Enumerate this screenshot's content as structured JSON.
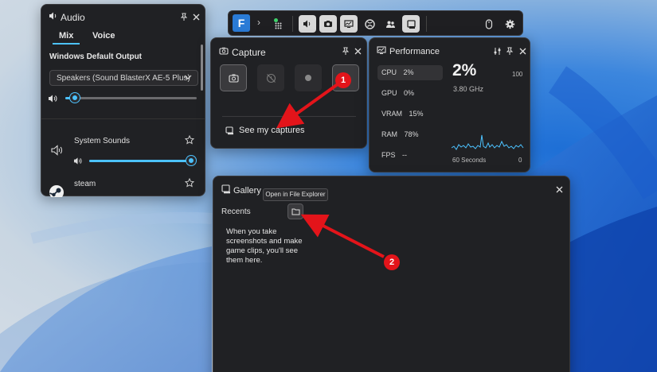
{
  "top_bar": {
    "buttons": [
      {
        "icon": "volume-icon",
        "active": true
      },
      {
        "icon": "camera-icon",
        "active": true
      },
      {
        "icon": "performance-icon",
        "active": true
      },
      {
        "icon": "xbox-icon",
        "active": false
      },
      {
        "icon": "social-icon",
        "active": false
      },
      {
        "icon": "gallery-icon",
        "active": true
      },
      {
        "icon": "mouse-icon",
        "active": false
      },
      {
        "icon": "settings-icon",
        "active": false
      }
    ]
  },
  "audio": {
    "title": "Audio",
    "tabs": [
      "Mix",
      "Voice"
    ],
    "active_tab": "Mix",
    "output_label": "Windows Default Output",
    "output_device": "Speakers (Sound BlasterX AE-5 Plus)",
    "master_volume": 0.07,
    "apps": [
      {
        "name": "System Sounds",
        "volume": 0.98
      },
      {
        "name": "steam"
      }
    ]
  },
  "capture": {
    "title": "Capture",
    "see_captures": "See my captures"
  },
  "performance": {
    "title": "Performance",
    "metrics": [
      {
        "label": "CPU",
        "value": "2%"
      },
      {
        "label": "GPU",
        "value": "0%"
      },
      {
        "label": "VRAM",
        "value": "15%"
      },
      {
        "label": "RAM",
        "value": "78%"
      },
      {
        "label": "FPS",
        "value": "--"
      }
    ],
    "big_value": "2%",
    "frequency": "3.80 GHz",
    "scale_max": "100",
    "time_span": "60 Seconds",
    "scale_min": "0"
  },
  "gallery": {
    "title": "Gallery",
    "recents": "Recents",
    "tooltip": "Open in File Explorer",
    "empty_text": "When you take screenshots and make game clips, you'll see them here."
  },
  "annotations": [
    "1",
    "2"
  ],
  "colors": {
    "accent": "#4cc2ff",
    "annotation": "#e3141a",
    "panel": "#202124"
  }
}
